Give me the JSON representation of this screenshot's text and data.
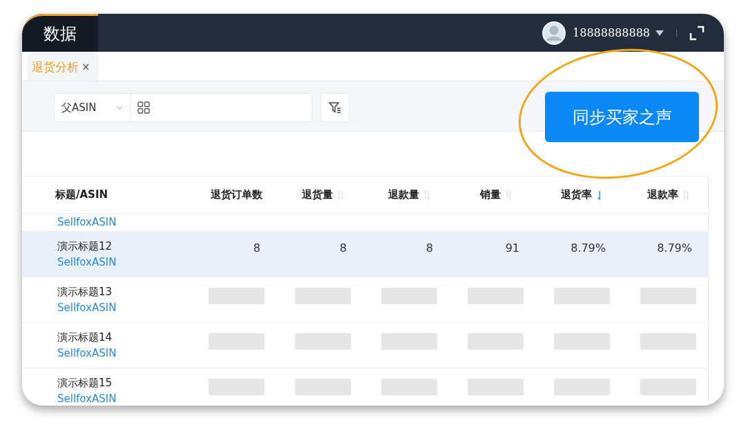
{
  "header": {
    "module": "数据",
    "user": "18888888888"
  },
  "tabs": [
    {
      "label": "退货分析",
      "selected": true,
      "close": "×"
    }
  ],
  "toolbar": {
    "select": "父ASIN",
    "sync_button": "同步买家之声"
  },
  "table": {
    "columns": [
      {
        "label": "标题/ASIN",
        "sortable": false
      },
      {
        "label": "退货订单数",
        "sortable": false
      },
      {
        "label": "退货量",
        "sortable": true,
        "sorted_descending": false
      },
      {
        "label": "退款量",
        "sortable": true,
        "sorted_descending": false
      },
      {
        "label": "销量",
        "sortable": true,
        "sorted_descending": false
      },
      {
        "label": "退货率",
        "sortable": true,
        "sorted_descending": true
      },
      {
        "label": "退款率",
        "sortable": true,
        "sorted_descending": false
      }
    ],
    "rows": [
      {
        "kind": "partial",
        "asin": "SellfoxASIN",
        "selected": false
      },
      {
        "kind": "values",
        "title": "演示标题12",
        "asin": "SellfoxASIN",
        "selected": true,
        "values": [
          "8",
          "8",
          "8",
          "91",
          "8.79%",
          "8.79%"
        ]
      },
      {
        "kind": "hidden",
        "title": "演示标题13",
        "asin": "SellfoxASIN",
        "selected": false
      },
      {
        "kind": "hidden",
        "title": "演示标题14",
        "asin": "SellfoxASIN",
        "selected": false
      },
      {
        "kind": "hidden",
        "title": "演示标题15",
        "asin": "SellfoxASIN",
        "selected": false
      }
    ]
  }
}
